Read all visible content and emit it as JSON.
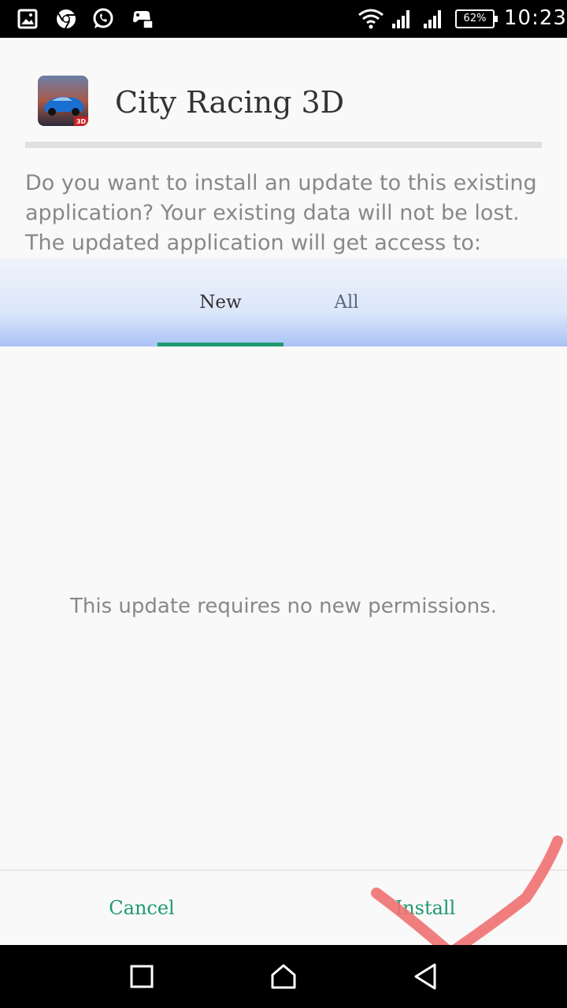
{
  "status_bar": {
    "icons": [
      "image-icon",
      "chrome-icon",
      "whatsapp-icon",
      "game-controller-icon",
      "wifi-icon",
      "signal-icon",
      "signal-icon"
    ],
    "battery": "62%",
    "time": "10:23"
  },
  "app": {
    "icon": "city-racing-app-icon",
    "title": "City Racing 3D",
    "icon_badge": "3D"
  },
  "description": "Do you want to install an update to this existing application? Your existing data will not be lost. The updated application will get access to:",
  "tabs": [
    {
      "label": "New",
      "selected": true
    },
    {
      "label": "All",
      "selected": false
    }
  ],
  "permissions_message": "This update requires no new permissions.",
  "buttons": {
    "cancel": "Cancel",
    "install": "Install"
  },
  "nav_bar": {
    "icons": [
      "recents-square-icon",
      "home-icon",
      "back-triangle-icon"
    ]
  },
  "colors": {
    "accent": "#1e9a6e",
    "tab_gradient_bottom": "#a9c2f6",
    "annotation_check": "#f07070"
  }
}
